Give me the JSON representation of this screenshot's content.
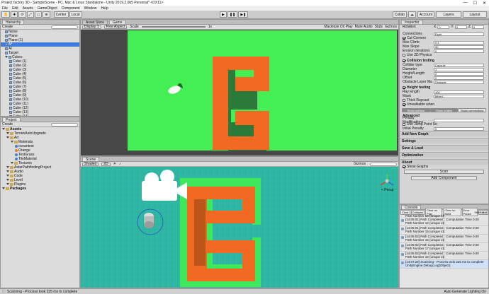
{
  "window": {
    "title": "Project factory 3D - SampleScene - PC, Mac & Linux Standalone - Unity 2019.2.0b5 Personal* <DX11>"
  },
  "menu": [
    "File",
    "Edit",
    "Assets",
    "GameObject",
    "Component",
    "Window",
    "Help"
  ],
  "toolbar": {
    "pivot": "Center",
    "space": "Local",
    "collab": "Collab",
    "account": "Account",
    "layers": "Layers",
    "layout": "Layout"
  },
  "hierarchy": {
    "tab": "Hierarchy",
    "create": "Create",
    "items": [
      {
        "label": "Noise",
        "indent": 1
      },
      {
        "label": "Plane",
        "indent": 1
      },
      {
        "label": "Plane (1)",
        "indent": 1
      },
      {
        "label": "A*",
        "indent": 1,
        "selected": true
      },
      {
        "label": "AI",
        "indent": 1
      },
      {
        "label": "Target",
        "indent": 1
      },
      {
        "label": "Cubes",
        "indent": 1
      },
      {
        "label": "Cube (1)",
        "indent": 2
      },
      {
        "label": "Cube (2)",
        "indent": 2
      },
      {
        "label": "Cube (3)",
        "indent": 2
      },
      {
        "label": "Cube (4)",
        "indent": 2
      },
      {
        "label": "Cube (5)",
        "indent": 2
      },
      {
        "label": "Cube (6)",
        "indent": 2
      },
      {
        "label": "Cube (7)",
        "indent": 2
      },
      {
        "label": "Cube (8)",
        "indent": 2
      },
      {
        "label": "Cube (9)",
        "indent": 2
      },
      {
        "label": "Cube (10)",
        "indent": 2
      },
      {
        "label": "Cube (11)",
        "indent": 2
      },
      {
        "label": "Cube (12)",
        "indent": 2
      },
      {
        "label": "Cube (13)",
        "indent": 2
      },
      {
        "label": "Cube (14)",
        "indent": 2
      },
      {
        "label": "Cube (15)",
        "indent": 2
      }
    ]
  },
  "project": {
    "tab": "Project",
    "create": "Create",
    "items": [
      {
        "label": "Assets",
        "indent": 0,
        "icon": "folder",
        "bold": true
      },
      {
        "label": "TerrainAutoUpgrade",
        "indent": 1,
        "icon": "folder"
      },
      {
        "label": "Art",
        "indent": 1,
        "icon": "folder"
      },
      {
        "label": "Materials",
        "indent": 2,
        "icon": "folder"
      },
      {
        "label": "oceantest",
        "indent": 3,
        "icon": "mat",
        "color": "#4b7bd1"
      },
      {
        "label": "Orange",
        "indent": 3,
        "icon": "mat",
        "color": "#f07a2c"
      },
      {
        "label": "TestGrass",
        "indent": 3,
        "icon": "mat",
        "color": "#4b7bd1"
      },
      {
        "label": "TileMaterial",
        "indent": 3,
        "icon": "mat",
        "color": "#4b7bd1"
      },
      {
        "label": "Textures",
        "indent": 2,
        "icon": "folder"
      },
      {
        "label": "AstarPathfindingProject",
        "indent": 1,
        "icon": "folder"
      },
      {
        "label": "Audio",
        "indent": 1,
        "icon": "folder"
      },
      {
        "label": "Code",
        "indent": 1,
        "icon": "folder"
      },
      {
        "label": "Level",
        "indent": 1,
        "icon": "folder"
      },
      {
        "label": "Plugins",
        "indent": 1,
        "icon": "folder"
      },
      {
        "label": "Packages",
        "indent": 0,
        "icon": "folder",
        "bold": true
      }
    ]
  },
  "game": {
    "tabs": [
      "Asset Store",
      "Game"
    ],
    "display": "Display 1",
    "aspect": "Free Aspect",
    "scale_label": "Scale",
    "scale_value": "1x",
    "options": [
      "Maximize On Play",
      "Mute Audio",
      "Stats",
      "Gizmos"
    ]
  },
  "scene": {
    "tab": "Scene",
    "shading": "Shaded",
    "mode": "2D",
    "gizmos": "Gizmos",
    "search_label": "All",
    "persp": "< Persp"
  },
  "inspector": {
    "tab": "Inspector",
    "rotation": {
      "label": "Rotation",
      "x": "0",
      "y": "0",
      "z": "0"
    },
    "rows": [
      {
        "label": "Connections",
        "value": "Eight"
      },
      {
        "label": "Cut Corners",
        "check": true
      },
      {
        "label": "Max Climb",
        "value": "0.4"
      },
      {
        "label": "Max Slope",
        "value": "90"
      },
      {
        "label": "Erosion iterations",
        "value": "0"
      },
      {
        "label": "Use 2D Physics",
        "check": false
      }
    ],
    "collision": {
      "title": "Collision testing",
      "rows": [
        {
          "label": "Collider type",
          "value": "Capsule"
        },
        {
          "label": "Diameter",
          "value": "1"
        },
        {
          "label": "Height/Length",
          "value": "2"
        },
        {
          "label": "Offset",
          "value": "0"
        },
        {
          "label": "Obstacle Layer Ma",
          "value": "Obstacle"
        }
      ]
    },
    "height": {
      "title": "Height testing",
      "rows": [
        {
          "label": "Ray length",
          "value": "100"
        },
        {
          "label": "Mask",
          "value": "Mixed..."
        },
        {
          "label": "Thick Raycast",
          "check": false
        },
        {
          "label": "Unwalkable when",
          "check": true
        }
      ]
    },
    "view_tabs": [
      "Show surface",
      "Show outline",
      "Show connections"
    ],
    "advanced": {
      "title": "Advanced",
      "rows": [
        {
          "label": "Penalty Modifications",
          "value": ""
        },
        {
          "label": "Use Jump Point Se",
          "check": false
        },
        {
          "label": "Initial Penalty",
          "value": "0"
        }
      ]
    },
    "add_graph": "Add New Graph",
    "sections": [
      "Settings",
      "Save & Load",
      "Optimization",
      "About"
    ],
    "show_graphs": "Show Graphs",
    "scan": "Scan",
    "add_component": "Add Component"
  },
  "console": {
    "tab": "Console",
    "buttons": [
      "Clear",
      "Collapse",
      "Clear on Play",
      "Clear on Build",
      "Error Pause",
      "Editor"
    ],
    "counts": {
      "log": "999+",
      "warn": "0",
      "err": "0"
    },
    "first": "Path Number 13 (unique id)",
    "lines": [
      {
        "a": "[14:05:01] Path Completed : Computation Time 0.00",
        "b": "Path Number 14 (unique id)"
      },
      {
        "a": "[14:05:01] Path Completed : Computation Time 0.00",
        "b": "Path Number 15 (unique id)"
      },
      {
        "a": "[14:05:02] Path Completed : Computation Time 0.00",
        "b": "Path Number 16 (unique id)"
      },
      {
        "a": "[14:05:02] Path Completed : Computation Time 0.00",
        "b": "Path Number 17 (unique id)"
      },
      {
        "a": "[14:05:02] Path Completed : Computation Time 0.00",
        "b": "Path Number 18 (unique id)"
      },
      {
        "a": "[14:07:29] Scanning - Process took 225 ms to complete",
        "b": "UnityEngine.Debug:Log(Object)"
      }
    ]
  },
  "status": {
    "text": "Scanning - Process took 225 ms to complete",
    "lighting": "Auto Generate Lighting On"
  }
}
